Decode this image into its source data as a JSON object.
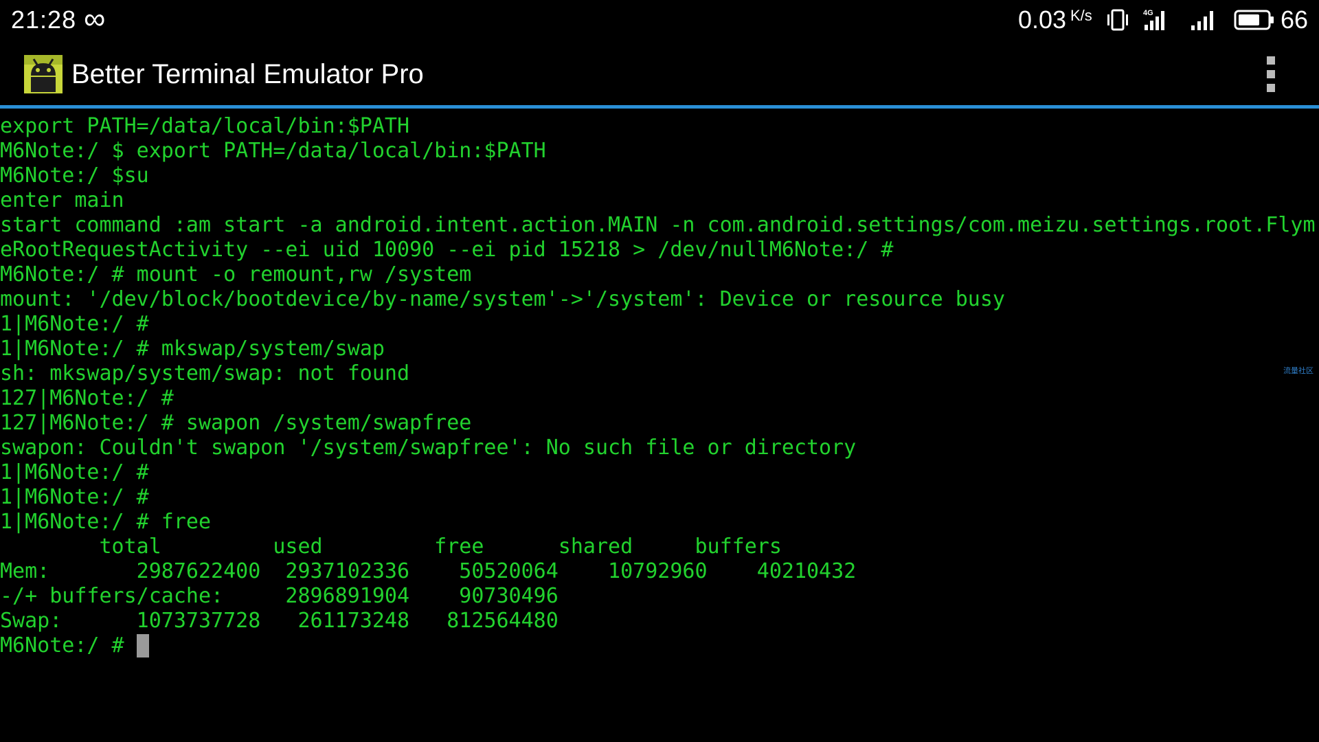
{
  "status_bar": {
    "time": "21:28",
    "infinity_glyph": "∞",
    "net_speed": "0.03",
    "net_speed_unit": "K/s",
    "battery_level": "66",
    "icons": [
      "infinity-icon",
      "vibrate-icon",
      "signal-4g-icon",
      "signal-icon",
      "battery-icon"
    ]
  },
  "app_bar": {
    "title": "Better Terminal Emulator Pro",
    "icon": "android-app-icon",
    "menu_icon": "overflow-menu-icon",
    "accent_color": "#2a8fd6"
  },
  "terminal": {
    "text_color": "#22d22e",
    "background": "#000000",
    "lines": [
      "export PATH=/data/local/bin:$PATH",
      "M6Note:/ $ export PATH=/data/local/bin:$PATH",
      "M6Note:/ $su",
      "enter main",
      "start command :am start -a android.intent.action.MAIN -n com.android.settings/com.meizu.settings.root.Flym",
      "eRootRequestActivity --ei uid 10090 --ei pid 15218 > /dev/nullM6Note:/ #",
      "M6Note:/ # mount -o remount,rw /system",
      "mount: '/dev/block/bootdevice/by-name/system'->'/system': Device or resource busy",
      "1|M6Note:/ #",
      "1|M6Note:/ # mkswap/system/swap",
      "sh: mkswap/system/swap: not found",
      "127|M6Note:/ #",
      "127|M6Note:/ # swapon /system/swapfree",
      "swapon: Couldn't swapon '/system/swapfree': No such file or directory",
      "1|M6Note:/ #",
      "1|M6Note:/ #",
      "1|M6Note:/ # free",
      "        total         used         free      shared     buffers",
      "Mem:       2987622400  2937102336    50520064    10792960    40210432",
      "-/+ buffers/cache:     2896891904    90730496",
      "Swap:      1073737728   261173248   812564480"
    ],
    "prompt": "M6Note:/ # "
  },
  "watermark": "流量社区"
}
